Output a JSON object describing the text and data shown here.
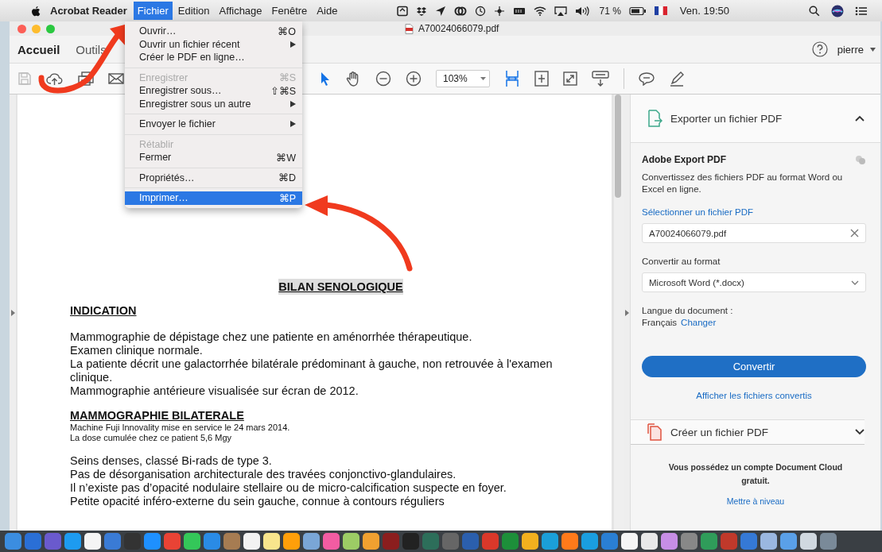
{
  "menubar": {
    "app": "Acrobat Reader",
    "menus": [
      {
        "label": "Fichier",
        "selected": true
      },
      {
        "label": "Edition",
        "selected": false
      },
      {
        "label": "Affichage",
        "selected": false
      },
      {
        "label": "Fenêtre",
        "selected": false
      },
      {
        "label": "Aide",
        "selected": false
      }
    ],
    "battery": "71 %",
    "clock": "Ven. 19:50"
  },
  "window": {
    "title": "A70024066079.pdf"
  },
  "tabs": [
    {
      "label": "Accueil",
      "selected": true
    },
    {
      "label": "Outils",
      "selected": false
    }
  ],
  "user": "pierre",
  "toolbar": {
    "zoom": "103%"
  },
  "file_menu": {
    "groups": [
      [
        {
          "label": "Ouvrir…",
          "shortcut": "⌘O",
          "submenu": false,
          "disabled": false,
          "selected": false
        },
        {
          "label": "Ouvrir un fichier récent",
          "submenu": true,
          "disabled": false,
          "selected": false
        },
        {
          "label": "Créer le PDF en ligne…",
          "submenu": false,
          "disabled": false,
          "selected": false
        }
      ],
      [
        {
          "label": "Enregistrer",
          "shortcut": "⌘S",
          "submenu": false,
          "disabled": true,
          "selected": false
        },
        {
          "label": "Enregistrer sous…",
          "shortcut": "⇧⌘S",
          "submenu": false,
          "disabled": false,
          "selected": false
        },
        {
          "label": "Enregistrer sous un autre",
          "submenu": true,
          "disabled": false,
          "selected": false
        }
      ],
      [
        {
          "label": "Envoyer le fichier",
          "submenu": true,
          "disabled": false,
          "selected": false
        }
      ],
      [
        {
          "label": "Rétablir",
          "submenu": false,
          "disabled": true,
          "selected": false
        },
        {
          "label": "Fermer",
          "shortcut": "⌘W",
          "submenu": false,
          "disabled": false,
          "selected": false
        }
      ],
      [
        {
          "label": "Propriétés…",
          "shortcut": "⌘D",
          "submenu": false,
          "disabled": false,
          "selected": false
        }
      ],
      [
        {
          "label": "Imprimer…",
          "shortcut": "⌘P",
          "submenu": false,
          "disabled": false,
          "selected": true
        }
      ]
    ]
  },
  "document": {
    "title": "BILAN SENOLOGIQUE",
    "blocks": [
      {
        "kind": "heading",
        "text": "INDICATION"
      },
      {
        "kind": "body",
        "lines": [
          "Mammographie de dépistage chez une patiente en aménorrhée thérapeutique.",
          "Examen clinique normale.",
          "La patiente décrit une galactorrhée bilatérale prédominant à gauche, non retrouvée à l'examen clinique.",
          "Mammographie antérieure visualisée sur écran de 2012."
        ]
      },
      {
        "kind": "heading",
        "text": "MAMMOGRAPHIE BILATERALE"
      },
      {
        "kind": "note",
        "lines": [
          "Machine Fuji Innovality mise en  service le 24 mars 2014.",
          "La dose cumulée chez ce patient 5,6 Mgy"
        ]
      },
      {
        "kind": "body",
        "lines": [
          "Seins denses, classé Bi-rads de type 3.",
          "Pas de désorganisation architecturale des travées conjonctivo-glandulaires.",
          "Il n’existe pas d’opacité nodulaire stellaire ou de micro-calcification suspecte en foyer.",
          "Petite opacité inféro-externe du sein gauche, connue à contours réguliers"
        ]
      }
    ]
  },
  "panel": {
    "export": {
      "title": "Exporter un fichier PDF",
      "expanded": true,
      "service": "Adobe Export PDF",
      "description": "Convertissez des fichiers PDF au format Word ou Excel en ligne.",
      "select_link": "Sélectionner un fichier PDF",
      "file": "A70024066079.pdf",
      "format_label": "Convertir au format",
      "format": "Microsoft Word (*.docx)",
      "language_label": "Langue du document :",
      "language": "Français",
      "change_link": "Changer",
      "button": "Convertir",
      "converted_link": "Afficher les fichiers convertis"
    },
    "create": {
      "title": "Créer un fichier PDF",
      "expanded": false
    },
    "notice": "Vous possédez un compte Document Cloud gratuit.",
    "upgrade_link": "Mettre à niveau"
  }
}
